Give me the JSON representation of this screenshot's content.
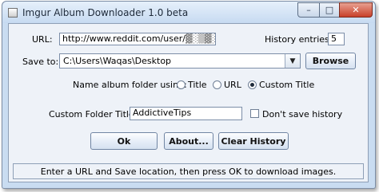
{
  "window": {
    "title": "Imgur Album Downloader 1.0 beta",
    "controls": {
      "minimize": "–",
      "maximize": "□",
      "close": "✕"
    }
  },
  "url": {
    "label": "URL:",
    "value": "http://www.reddit.com/user/",
    "obscured_suffix": "▓░▒▓░"
  },
  "history": {
    "label": "History entries:",
    "value": "5"
  },
  "save_to": {
    "label": "Save to:",
    "value": "C:\\Users\\Waqas\\Desktop",
    "dropdown_icon": "chevron-down-icon",
    "browse_label": "Browse"
  },
  "album_folder": {
    "label": "Name album folder using:",
    "options": [
      "Title",
      "URL",
      "Custom Title"
    ],
    "selected": "Custom Title"
  },
  "custom_folder": {
    "label": "Custom Folder Title:",
    "value": "AddictiveTips",
    "dont_save_label": "Don't save history",
    "dont_save_checked": false
  },
  "buttons": {
    "ok": "Ok",
    "about": "About...",
    "clear_history": "Clear History"
  },
  "status": "Enter a URL and Save location, then press OK to download images."
}
